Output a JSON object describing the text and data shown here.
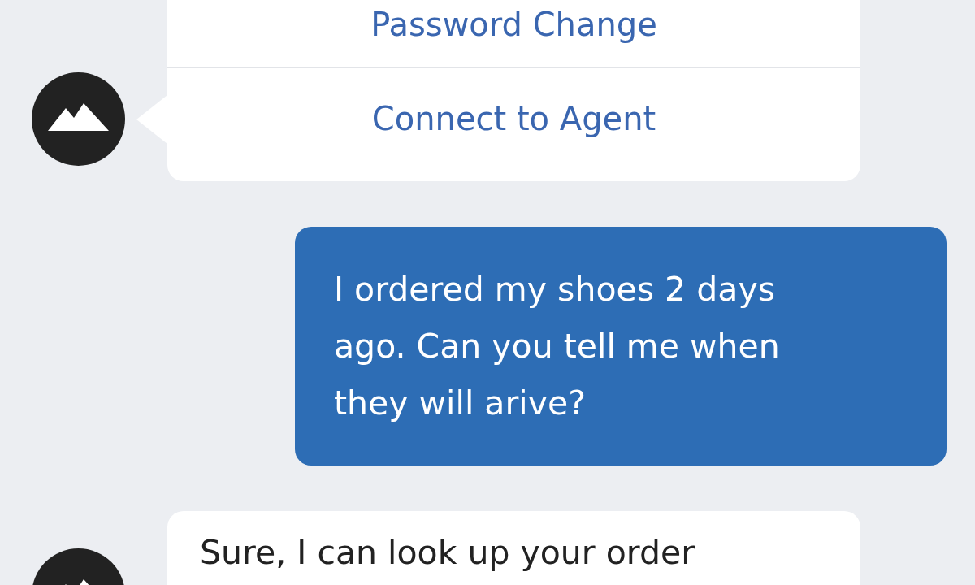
{
  "messages": [
    {
      "kind": "options",
      "options": [
        {
          "label": "Password Change"
        },
        {
          "label": "Connect to Agent"
        }
      ]
    },
    {
      "kind": "outgoing",
      "text": "I ordered my shoes 2 days ago. Can you tell me when they will arive?"
    },
    {
      "kind": "incoming",
      "text": "Sure, I can look up your order"
    }
  ]
}
